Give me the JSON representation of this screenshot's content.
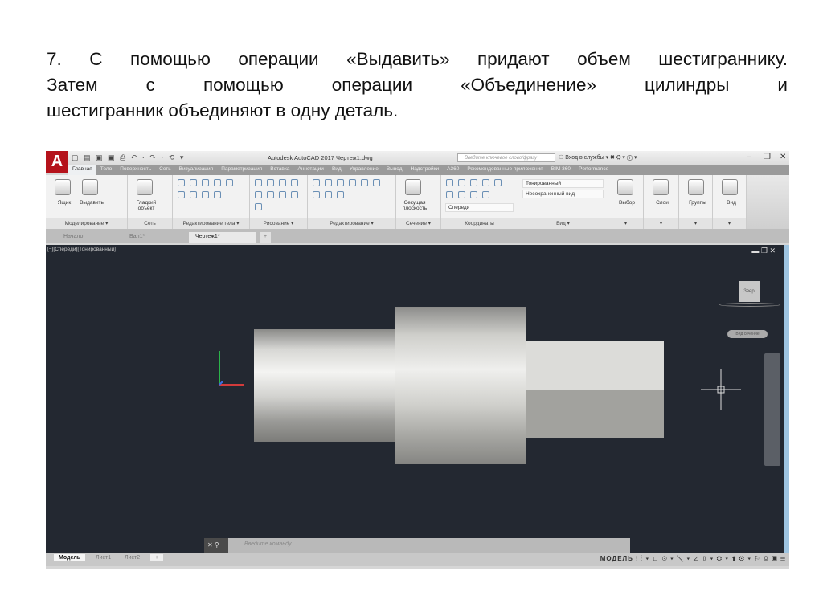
{
  "slide": {
    "lines": [
      "7. С помощью операции «Выдавить» придают объем шестиграннику.",
      "Затем с помощью операции «Объединение» цилиндры и",
      "шестигранник объединяют в одну деталь."
    ]
  },
  "app": {
    "logo": "A",
    "title": "Autodesk AutoCAD 2017   Чертеж1.dwg",
    "search_placeholder": "Введите ключевое слово/фразу",
    "signin": "Вход в службы",
    "tabs": [
      "Главная",
      "Тело",
      "Поверхность",
      "Сеть",
      "Визуализация",
      "Параметризация",
      "Вставка",
      "Аннотации",
      "Вид",
      "Управление",
      "Вывод",
      "Надстройки",
      "A360",
      "Рекомендованные приложения",
      "BIM 360",
      "Performance"
    ],
    "ribbon": {
      "panels": [
        {
          "label": "Моделирование ▾",
          "buttons": [
            "Ящик",
            "Выдавить"
          ]
        },
        {
          "label": "Сеть",
          "buttons": [
            "Гладкий объект"
          ]
        },
        {
          "label": "Редактирование тела ▾",
          "buttons": []
        },
        {
          "label": "Рисование ▾",
          "buttons": []
        },
        {
          "label": "Редактирование ▾",
          "buttons": []
        },
        {
          "label": "Сечение ▾",
          "buttons": [
            "Секущая плоскость"
          ]
        },
        {
          "label": "Координаты",
          "buttons": [
            "Спереди"
          ]
        },
        {
          "label": "Вид ▾",
          "buttons": [
            "Тонированный",
            "Несохраненный вид"
          ]
        },
        {
          "label": "▾",
          "buttons": [
            "Выбор"
          ]
        },
        {
          "label": "▾",
          "buttons": [
            "Слои"
          ]
        },
        {
          "label": "▾",
          "buttons": [
            "Группы"
          ]
        },
        {
          "label": "▾",
          "buttons": [
            "Вид"
          ]
        }
      ]
    },
    "file_tabs": [
      "Начало",
      "Вал1*",
      "Чертеж1*",
      "+"
    ],
    "viewport": {
      "label": "[−][Спереди][Тонированный]",
      "viewcube": "Звер",
      "wcs": "Вид сечение"
    },
    "command_placeholder": "Введите команду",
    "layout_tabs": [
      "Модель",
      "Лист1",
      "Лист2",
      "+"
    ],
    "status_mode": "МОДЕЛЬ"
  }
}
